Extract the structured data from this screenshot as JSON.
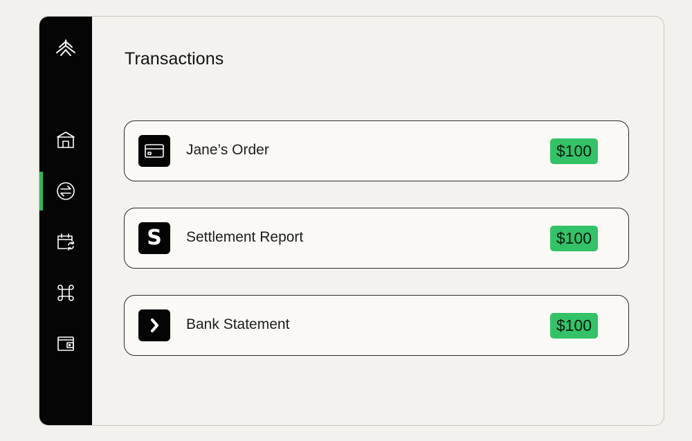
{
  "page": {
    "title": "Transactions"
  },
  "sidebar": {
    "items": [
      {
        "name": "bank-icon",
        "active": false
      },
      {
        "name": "transfer-icon",
        "active": true
      },
      {
        "name": "calendar-sync-icon",
        "active": false
      },
      {
        "name": "command-icon",
        "active": false
      },
      {
        "name": "wallet-icon",
        "active": false
      }
    ],
    "accent_color": "#2fb85a"
  },
  "transactions": [
    {
      "label": "Jane’s Order",
      "amount": "$100",
      "icon": "credit-card-icon"
    },
    {
      "label": "Settlement Report",
      "amount": "$100",
      "icon": "s-logo-icon",
      "icon_text": "S"
    },
    {
      "label": "Bank Statement",
      "amount": "$100",
      "icon": "chevron-right-icon"
    }
  ],
  "colors": {
    "sidebar": "#050505",
    "amount_badge": "#33c267"
  }
}
